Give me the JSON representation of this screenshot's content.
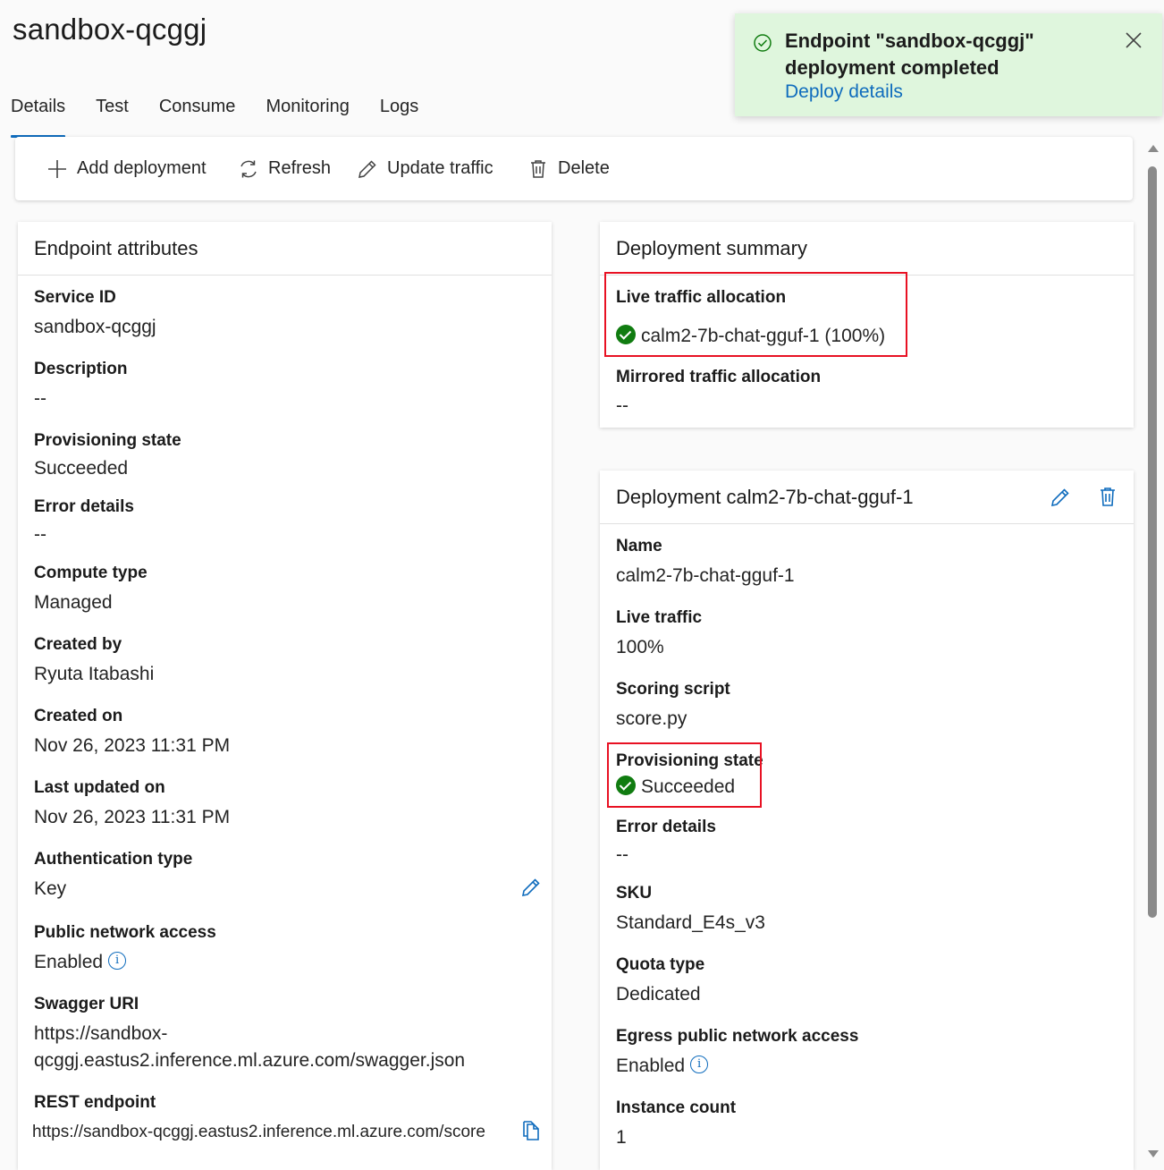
{
  "page": {
    "title": "sandbox-qcggj"
  },
  "tabs": [
    {
      "label": "Details",
      "active": true
    },
    {
      "label": "Test"
    },
    {
      "label": "Consume"
    },
    {
      "label": "Monitoring"
    },
    {
      "label": "Logs"
    }
  ],
  "toast": {
    "message": "Endpoint \"sandbox-qcggj\" deployment completed",
    "link": "Deploy details",
    "icon": "checkmark-circle-icon",
    "background": "#dff6dd"
  },
  "toolbar": {
    "add_deployment": "Add deployment",
    "refresh": "Refresh",
    "update_traffic": "Update traffic",
    "delete": "Delete"
  },
  "endpoint_attributes": {
    "title": "Endpoint attributes",
    "service_id_label": "Service ID",
    "service_id": "sandbox-qcggj",
    "description_label": "Description",
    "description": "--",
    "provisioning_state_label": "Provisioning state",
    "provisioning_state": "Succeeded",
    "error_details_label": "Error details",
    "error_details": "--",
    "compute_type_label": "Compute type",
    "compute_type": "Managed",
    "created_by_label": "Created by",
    "created_by": "Ryuta Itabashi",
    "created_on_label": "Created on",
    "created_on": "Nov 26, 2023 11:31 PM",
    "last_updated_label": "Last updated on",
    "last_updated": "Nov 26, 2023 11:31 PM",
    "auth_type_label": "Authentication type",
    "auth_type": "Key",
    "public_network_label": "Public network access",
    "public_network": "Enabled",
    "swagger_label": "Swagger URI",
    "swagger_line1": "https://sandbox-",
    "swagger_line2": "qcggj.eastus2.inference.ml.azure.com/swagger.json",
    "rest_label": "REST endpoint",
    "rest": "https://sandbox-qcggj.eastus2.inference.ml.azure.com/score"
  },
  "deployment_summary": {
    "title": "Deployment summary",
    "live_traffic_label": "Live traffic allocation",
    "live_traffic": "calm2-7b-chat-gguf-1 (100%)",
    "mirrored_label": "Mirrored traffic allocation",
    "mirrored": "--"
  },
  "deployment": {
    "title": "Deployment calm2-7b-chat-gguf-1",
    "name_label": "Name",
    "name": "calm2-7b-chat-gguf-1",
    "live_traffic_label": "Live traffic",
    "live_traffic": "100%",
    "scoring_label": "Scoring script",
    "scoring": "score.py",
    "provisioning_label": "Provisioning state",
    "provisioning": "Succeeded",
    "error_label": "Error details",
    "error": "--",
    "sku_label": "SKU",
    "sku": "Standard_E4s_v3",
    "quota_label": "Quota type",
    "quota": "Dedicated",
    "egress_label": "Egress public network access",
    "egress": "Enabled",
    "instance_label": "Instance count",
    "instance": "1"
  },
  "colors": {
    "accent": "#0f6cbd",
    "success": "#107c10",
    "highlight": "#e81123"
  }
}
